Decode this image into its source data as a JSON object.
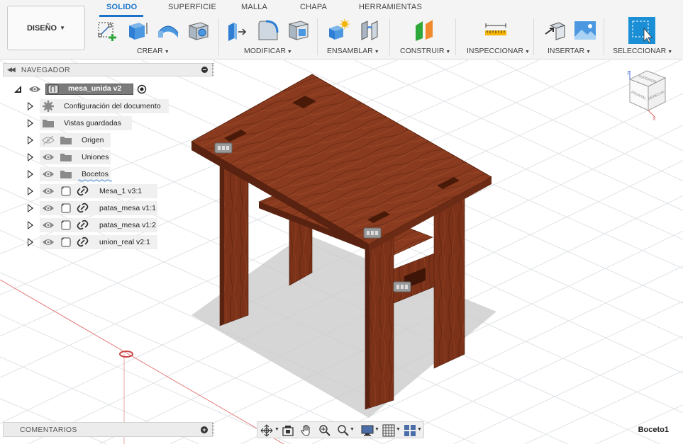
{
  "workspace": {
    "label": "DISEÑO"
  },
  "tabs": [
    {
      "id": "solido",
      "label": "SOLIDO",
      "active": true
    },
    {
      "id": "superficie",
      "label": "SUPERFICIE"
    },
    {
      "id": "malla",
      "label": "MALLA"
    },
    {
      "id": "chapa",
      "label": "CHAPA"
    },
    {
      "id": "herramientas",
      "label": "HERRAMIENTAS"
    }
  ],
  "groups": {
    "crear": "CREAR",
    "modificar": "MODIFICAR",
    "ensamblar": "ENSAMBLAR",
    "construir": "CONSTRUIR",
    "inspeccionar": "INSPECCIONAR",
    "insertar": "INSERTAR",
    "seleccionar": "SELECCIONAR"
  },
  "browser": {
    "title": "NAVEGADOR",
    "root": "mesa_unida v2",
    "items": [
      {
        "label": "Configuración del documento",
        "icon": "gear-icon"
      },
      {
        "label": "Vistas guardadas",
        "icon": "folder-icon"
      },
      {
        "label": "Origen",
        "icon": "folder-icon",
        "visible": false
      },
      {
        "label": "Uniones",
        "icon": "folder-icon",
        "visible": true
      },
      {
        "label": "Bocetos",
        "icon": "folder-icon",
        "visible": true
      },
      {
        "label": "Mesa_1 v3:1",
        "icon": "component-link-icon",
        "visible": true
      },
      {
        "label": "patas_mesa v1:1",
        "icon": "component-link-icon",
        "visible": true
      },
      {
        "label": "patas_mesa v1:2",
        "icon": "component-link-icon",
        "visible": true
      },
      {
        "label": "union_real v2:1",
        "icon": "component-link-icon",
        "visible": true
      }
    ]
  },
  "comments": {
    "title": "COMENTARIOS"
  },
  "status": {
    "active_sketch": "Boceto1"
  },
  "viewcube": {
    "faces": [
      "SUPERIOR",
      "FRONTAL",
      "DERECHA"
    ],
    "axes": [
      "Z",
      "X"
    ]
  },
  "colors": {
    "accent": "#1a73c8",
    "wood": "#8b3a1e",
    "grid": "#d9dde2",
    "x_axis": "#e06060"
  }
}
